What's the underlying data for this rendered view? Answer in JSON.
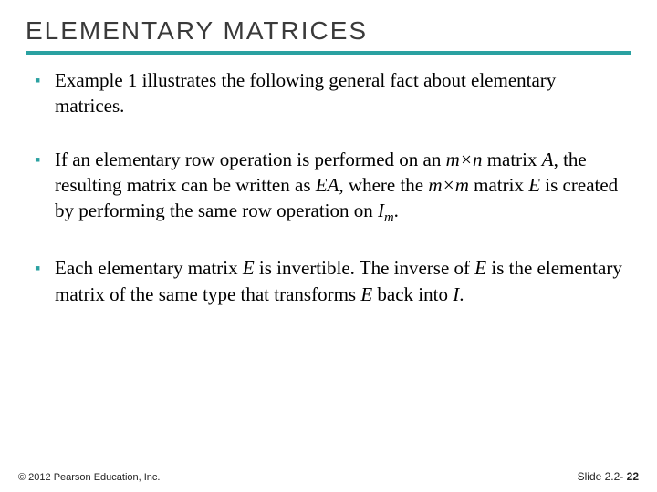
{
  "title": "ELEMENTARY MATRICES",
  "bullets": {
    "b1": "Example 1 illustrates the following general fact about elementary matrices.",
    "b2": {
      "t1": "If an elementary row operation is performed on an ",
      "mxn_m": "m",
      "times": "×",
      "mxn_n": "n",
      "t2": " matrix ",
      "A": "A",
      "t3": ", the resulting matrix can be written as ",
      "EA": "EA",
      "t4": ", where the ",
      "mxm_m1": "m",
      "mxm_m2": "m",
      "t5": " matrix ",
      "E": "E",
      "t6": " is created by performing the same row operation on ",
      "I": "I",
      "Isub": "m",
      "t7": "."
    },
    "b3": {
      "t1": "Each elementary matrix ",
      "E1": "E",
      "t2": " is invertible. The inverse of ",
      "E2": "E",
      "t3": " is the elementary matrix of the same type that transforms ",
      "E3": "E",
      "t4": " back into ",
      "I": "I",
      "t5": "."
    }
  },
  "footer": {
    "copyright": "© 2012 Pearson Education, Inc.",
    "slide_label": "Slide 2.2- ",
    "slide_number": "22"
  }
}
